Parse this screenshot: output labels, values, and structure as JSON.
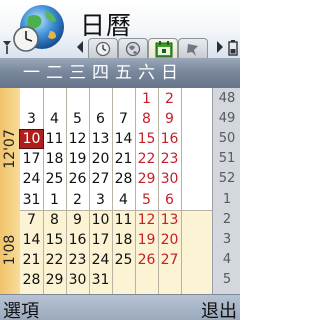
{
  "header": {
    "title": "日曆",
    "app_icon": "calendar-globe-clock-icon",
    "signal_icon": "signal-strength-icon",
    "battery_icon": "battery-icon"
  },
  "tabs": [
    {
      "name": "clock-tab",
      "icon": "clock-icon",
      "active": false
    },
    {
      "name": "globe-tab",
      "icon": "globe-icon",
      "active": false
    },
    {
      "name": "month-view-tab",
      "icon": "month-view-icon",
      "active": true
    },
    {
      "name": "todo-tab",
      "icon": "todo-icon",
      "active": false
    }
  ],
  "weekdays": [
    "一",
    "二",
    "三",
    "四",
    "五",
    "六",
    "日"
  ],
  "month_labels": {
    "first": "12'07",
    "second": "1'08"
  },
  "weeks": [
    {
      "week": "48",
      "days": [
        "",
        "",
        "",
        "",
        "",
        "1",
        "2"
      ]
    },
    {
      "week": "49",
      "days": [
        "3",
        "4",
        "5",
        "6",
        "7",
        "8",
        "9"
      ]
    },
    {
      "week": "50",
      "days": [
        "10",
        "11",
        "12",
        "13",
        "14",
        "15",
        "16"
      ]
    },
    {
      "week": "51",
      "days": [
        "17",
        "18",
        "19",
        "20",
        "21",
        "22",
        "23"
      ]
    },
    {
      "week": "52",
      "days": [
        "24",
        "25",
        "26",
        "27",
        "28",
        "29",
        "30"
      ]
    },
    {
      "week": "1",
      "days": [
        "31",
        "1",
        "2",
        "3",
        "4",
        "5",
        "6"
      ]
    },
    {
      "week": "2",
      "days": [
        "7",
        "8",
        "9",
        "10",
        "11",
        "12",
        "13"
      ]
    },
    {
      "week": "3",
      "days": [
        "14",
        "15",
        "16",
        "17",
        "18",
        "19",
        "20"
      ]
    },
    {
      "week": "4",
      "days": [
        "21",
        "22",
        "23",
        "24",
        "25",
        "26",
        "27"
      ]
    },
    {
      "week": "5",
      "days": [
        "28",
        "29",
        "30",
        "31",
        "",
        "",
        ""
      ]
    }
  ],
  "selected_day": "10",
  "softkeys": {
    "left": "選項",
    "right": "退出"
  },
  "colors": {
    "weekend": "#c51f2a",
    "selected_day_bg": "#b01d1d",
    "month_column": "#f0c36a",
    "next_month_bg": "#fbf3d4"
  }
}
